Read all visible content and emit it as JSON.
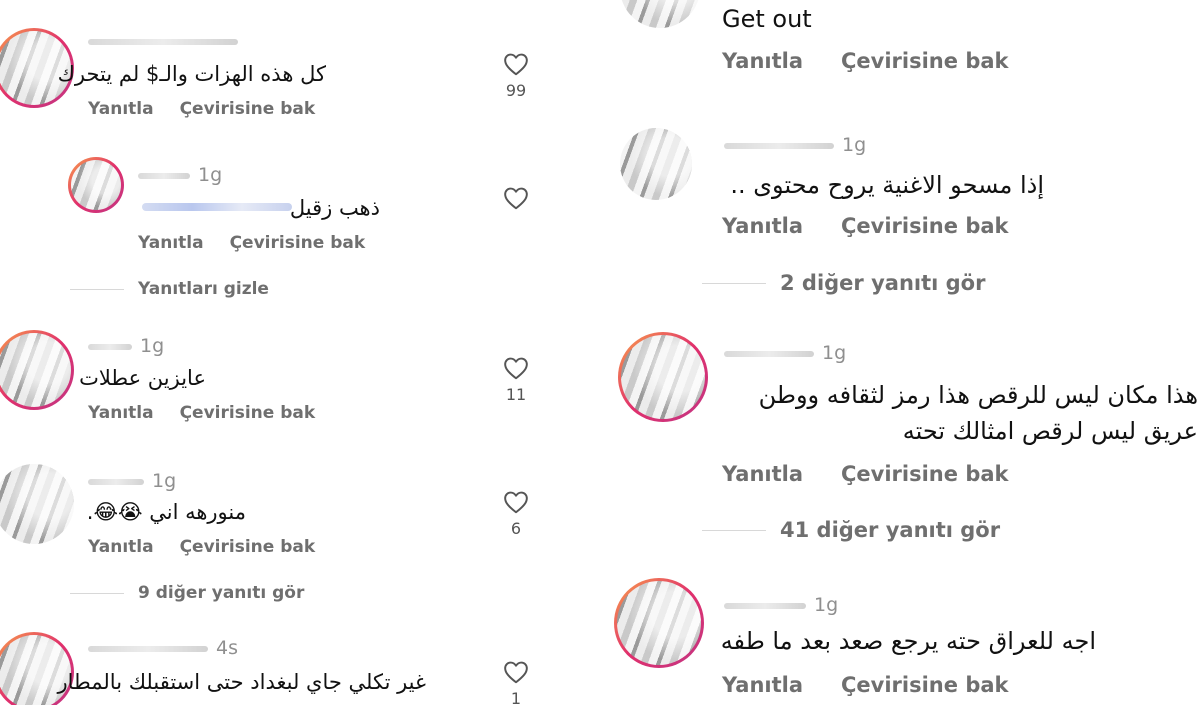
{
  "actions": {
    "reply": "Yanıtla",
    "translate": "Çevirisine bak"
  },
  "left": {
    "comments": [
      {
        "time": "",
        "text": "كل هذه الهزات والـ$ لم يتحرك",
        "likes": "99"
      },
      {
        "time": "1g",
        "text": "ذهب زقيل",
        "likes": ""
      },
      {
        "time": "1g",
        "text": "عايزين عطلات",
        "likes": "11"
      },
      {
        "time": "1g",
        "text": "منورهه اني 😭😂.",
        "likes": "6"
      },
      {
        "time": "4s",
        "text": "غير تكلي جاي لبغداد حتى استقبلك بالمطار",
        "likes": "1"
      }
    ],
    "hide_replies": "Yanıtları gizle",
    "more_replies": "9 diğer yanıtı gör"
  },
  "right": {
    "comments": [
      {
        "time": "",
        "text": [
          "Get out"
        ]
      },
      {
        "time": "1g",
        "text": [
          "إذا مسحو الاغنية يروح محتوى .."
        ]
      },
      {
        "time": "1g",
        "text": [
          "هذا مكان ليس للرقص هذا رمز لثقافه ووطن",
          "عريق ليس لرقص امثالك تحته"
        ]
      },
      {
        "time": "1g",
        "text": [
          "اجه للعراق حته يرجع صعد بعد ما طفه"
        ]
      }
    ],
    "more_replies_a": "2 diğer yanıtı gör",
    "more_replies_b": "41 diğer yanıtı gör"
  },
  "icons": {
    "like": "heart-outline-icon"
  },
  "colors": {
    "text": "#111111",
    "muted": "#6f6f6f",
    "avatar_ring": "#e1306c"
  }
}
